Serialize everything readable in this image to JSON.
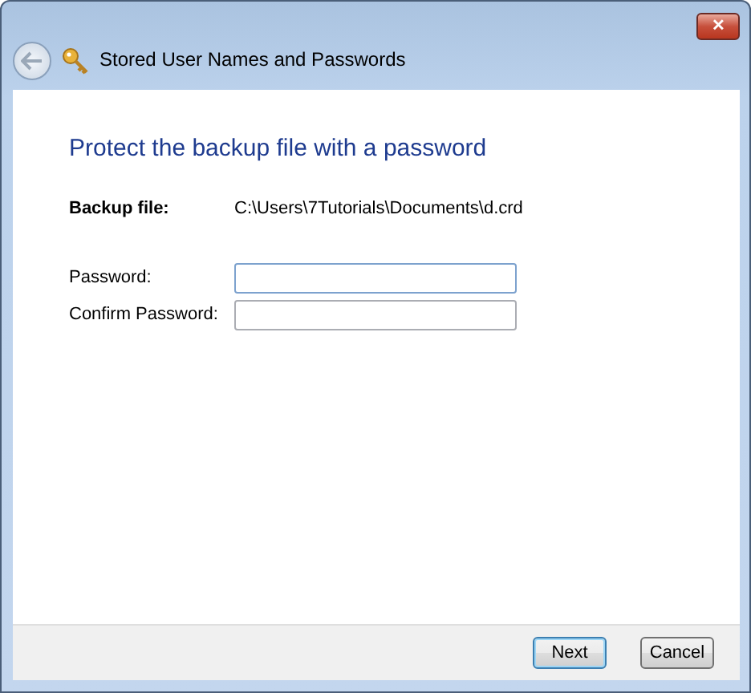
{
  "window": {
    "title": "Stored User Names and Passwords",
    "close": "✕"
  },
  "heading": "Protect the backup file with a password",
  "backup_file": {
    "label": "Backup file:",
    "value": "C:\\Users\\7Tutorials\\Documents\\d.crd"
  },
  "fields": [
    {
      "label": "Password:"
    },
    {
      "label": "Confirm Password:"
    }
  ],
  "buttons": [
    {
      "label": "Next",
      "default": true
    },
    {
      "label": "Cancel",
      "default": false
    }
  ]
}
